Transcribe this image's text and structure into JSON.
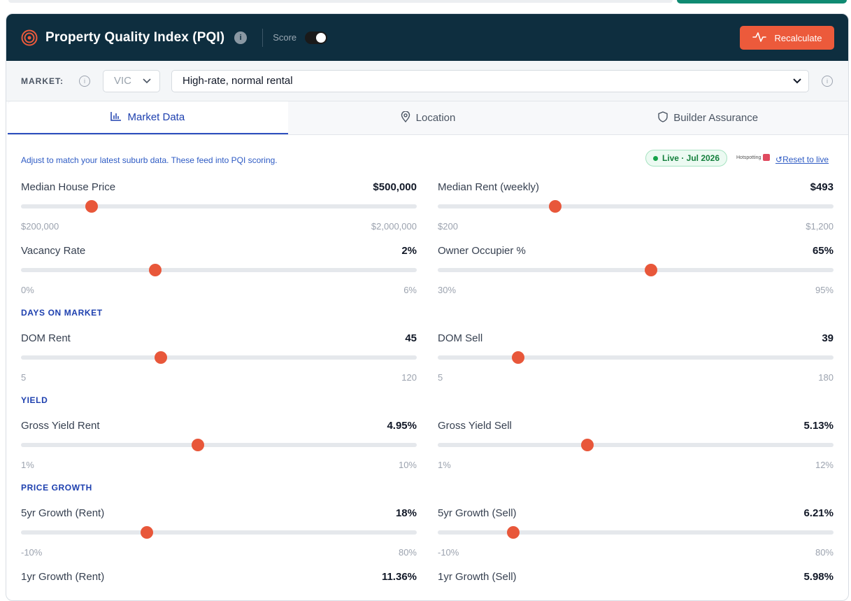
{
  "header": {
    "title": "Property Quality Index (PQI)",
    "info_icon": "i",
    "score_label": "Score",
    "recalculate_label": "Recalculate"
  },
  "market": {
    "label": "MARKET:",
    "state": "VIC",
    "scenario": "High-rate, normal rental"
  },
  "tabs": [
    {
      "label": "Market Data",
      "icon": "bar-chart-icon"
    },
    {
      "label": "Location",
      "icon": "map-pin-icon"
    },
    {
      "label": "Builder Assurance",
      "icon": "shield-icon"
    }
  ],
  "content": {
    "note": "Adjust to match your latest suburb data. These feed into PQI scoring.",
    "live_badge": "Live · Jul 2026",
    "source_logo": "Hotspotting",
    "reset_label": "Reset to live"
  },
  "sections": {
    "days_on_market": "DAYS ON MARKET",
    "yield": "YIELD",
    "price_growth": "PRICE GROWTH"
  },
  "sliders": {
    "median_price": {
      "label": "Median House Price",
      "value": "$500,000",
      "min": "$200,000",
      "max": "$2,000,000",
      "fraction": 0.178
    },
    "median_rent": {
      "label": "Median Rent (weekly)",
      "value": "$493",
      "min": "$200",
      "max": "$1,200",
      "fraction": 0.297
    },
    "vacancy": {
      "label": "Vacancy Rate",
      "value": "2%",
      "min": "0%",
      "max": "6%",
      "fraction": 0.34
    },
    "owner_occ": {
      "label": "Owner Occupier %",
      "value": "65%",
      "min": "30%",
      "max": "95%",
      "fraction": 0.538
    },
    "dom_rent": {
      "label": "DOM Rent",
      "value": "45",
      "min": "5",
      "max": "120",
      "fraction": 0.353
    },
    "dom_sell": {
      "label": "DOM Sell",
      "value": "39",
      "min": "5",
      "max": "180",
      "fraction": 0.204
    },
    "yield_rent": {
      "label": "Gross Yield Rent",
      "value": "4.95%",
      "min": "1%",
      "max": "10%",
      "fraction": 0.447
    },
    "yield_sell": {
      "label": "Gross Yield Sell",
      "value": "5.13%",
      "min": "1%",
      "max": "12%",
      "fraction": 0.378
    },
    "growth5_rent": {
      "label": "5yr Growth (Rent)",
      "value": "18%",
      "min": "-10%",
      "max": "80%",
      "fraction": 0.318
    },
    "growth5_sell": {
      "label": "5yr Growth (Sell)",
      "value": "6.21%",
      "min": "-10%",
      "max": "80%",
      "fraction": 0.19
    },
    "growth1_rent": {
      "label": "1yr Growth (Rent)",
      "value": "11.36%"
    },
    "growth1_sell": {
      "label": "1yr Growth (Sell)",
      "value": "5.98%"
    }
  },
  "colors": {
    "header_bg": "#0e2e3f",
    "accent_orange": "#e8573a",
    "link_blue": "#2e5bc4",
    "live_green": "#15803d"
  }
}
